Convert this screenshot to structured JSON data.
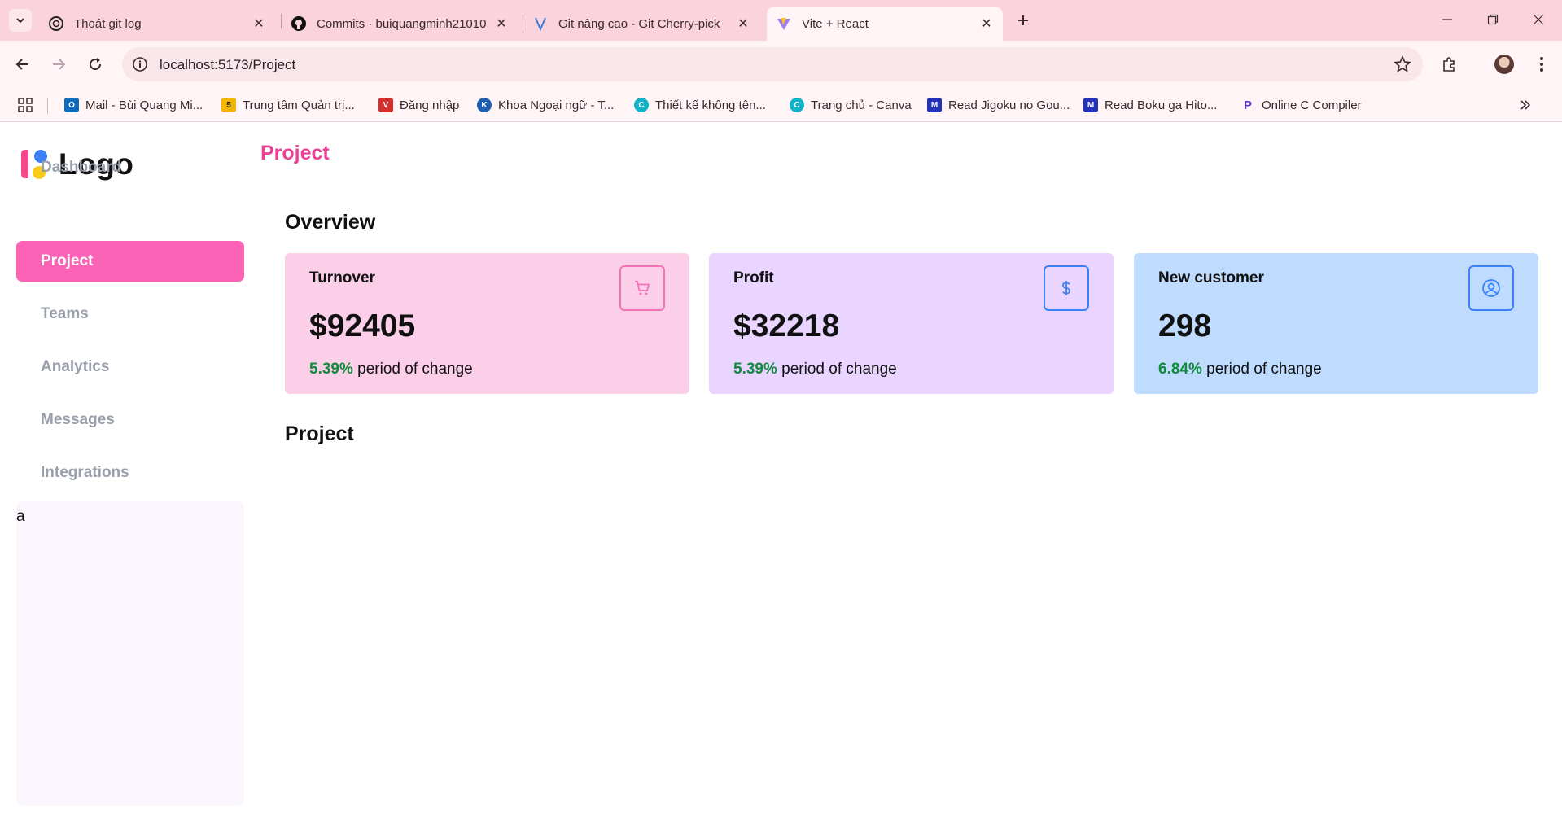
{
  "browser": {
    "tabs": [
      {
        "title": "Thoát git log",
        "icon": "chatgpt-icon"
      },
      {
        "title": "Commits · buiquangminh21010",
        "icon": "github-icon"
      },
      {
        "title": "Git nâng cao - Git Cherry-pick",
        "icon": "viblo-icon"
      },
      {
        "title": "Vite + React",
        "icon": "vite-icon"
      }
    ],
    "url": "localhost:5173/Project",
    "bookmarks": [
      {
        "label": "Mail - Bùi Quang Mi..."
      },
      {
        "label": "Trung tâm Quản trị..."
      },
      {
        "label": "Đăng nhập"
      },
      {
        "label": "Khoa Ngoại ngữ - T..."
      },
      {
        "label": "Thiết kế không tên..."
      },
      {
        "label": "Trang chủ - Canva"
      },
      {
        "label": "Read Jigoku no Gou..."
      },
      {
        "label": "Read Boku ga Hito..."
      },
      {
        "label": "Online C Compiler"
      }
    ]
  },
  "app": {
    "logo_text": "Logo",
    "page_title": "Project",
    "nav": [
      {
        "label": "Dashboard",
        "active": false
      },
      {
        "label": "Project",
        "active": true
      },
      {
        "label": "Teams",
        "active": false
      },
      {
        "label": "Analytics",
        "active": false
      },
      {
        "label": "Messages",
        "active": false
      },
      {
        "label": "Integrations",
        "active": false
      }
    ],
    "side_panel_text": "a",
    "overview_title": "Overview",
    "cards": [
      {
        "label": "Turnover",
        "value": "$92405",
        "change_pct": "5.39%",
        "change_text": " period of change",
        "icon": "cart-icon",
        "bg": "#fbcfe8",
        "accent": "#f472b6"
      },
      {
        "label": "Profit",
        "value": "$32218",
        "change_pct": "5.39%",
        "change_text": " period of change",
        "icon": "dollar-icon",
        "bg": "#e9d5ff",
        "accent": "#3b82f6"
      },
      {
        "label": "New customer",
        "value": "298",
        "change_pct": "6.84%",
        "change_text": " period of change",
        "icon": "user-circle-icon",
        "bg": "#bfdbfe",
        "accent": "#3b82f6"
      }
    ],
    "project_section_title": "Project"
  }
}
